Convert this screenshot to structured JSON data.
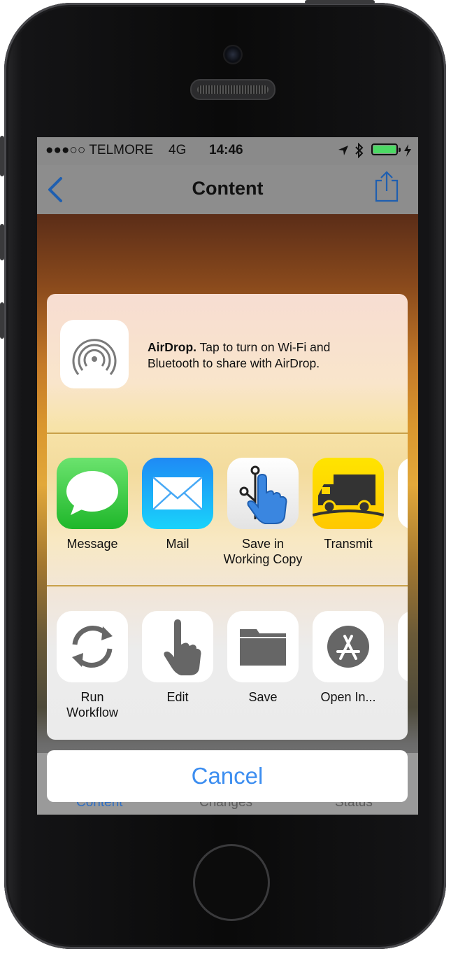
{
  "status_bar": {
    "carrier": "●●●○○ TELMORE",
    "network": "4G",
    "time": "14:46"
  },
  "nav": {
    "title": "Content",
    "back_icon": "chevron-left-icon",
    "share_icon": "share-icon"
  },
  "tab_bar": {
    "tabs": [
      "Content",
      "Changes",
      "Status"
    ]
  },
  "share_sheet": {
    "airdrop": {
      "title": "AirDrop.",
      "text": "Tap to turn on Wi-Fi and Bluetooth to share with AirDrop."
    },
    "apps": [
      {
        "label": "Message",
        "icon": "messages-icon"
      },
      {
        "label": "Mail",
        "icon": "mail-icon"
      },
      {
        "label": "Save in\nWorking Copy",
        "icon": "working-copy-icon"
      },
      {
        "label": "Transmit",
        "icon": "transmit-truck-icon"
      }
    ],
    "actions": [
      {
        "label": "Run\nWorkflow",
        "icon": "refresh-icon"
      },
      {
        "label": "Edit",
        "icon": "pointing-hand-icon"
      },
      {
        "label": "Save",
        "icon": "folder-icon"
      },
      {
        "label": "Open In...",
        "icon": "app-store-icon"
      }
    ],
    "cancel_label": "Cancel"
  },
  "colors": {
    "accent": "#3d8ef0",
    "battery": "#4cd964"
  }
}
